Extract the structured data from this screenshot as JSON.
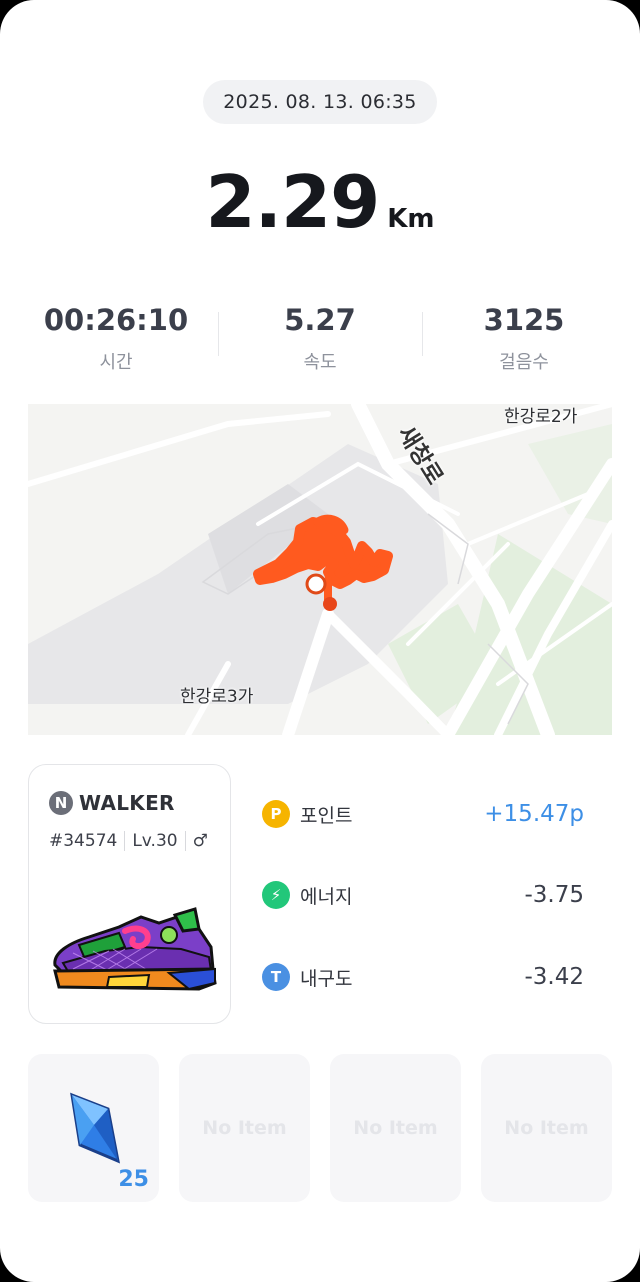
{
  "session": {
    "datetime": "2025. 08. 13. 06:35",
    "distance": "2.29",
    "distance_unit": "Km"
  },
  "stats": [
    {
      "value": "00:26:10",
      "label": "시간"
    },
    {
      "value": "5.27",
      "label": "속도"
    },
    {
      "value": "3125",
      "label": "걸음수"
    }
  ],
  "map": {
    "labels": {
      "area_top": "한강로2가",
      "road": "새창로",
      "area_bottom": "한강로3가"
    },
    "route_color": "#ff5a1f"
  },
  "walker": {
    "badge": "N",
    "name": "WALKER",
    "id": "#34574",
    "level": "Lv.30",
    "gender_symbol": "♂"
  },
  "rewards": [
    {
      "icon": "point-icon",
      "icon_text": "P",
      "color": "#f6b400",
      "label": "포인트",
      "value": "+15.47p",
      "positive": true
    },
    {
      "icon": "energy-icon",
      "icon_text": "⚡",
      "color": "#22c77a",
      "label": "에너지",
      "value": "-3.75",
      "positive": false
    },
    {
      "icon": "durability-icon",
      "icon_text": "T",
      "color": "#4a90e2",
      "label": "내구도",
      "value": "-3.42",
      "positive": false
    }
  ],
  "items": [
    {
      "type": "gem",
      "count": "25"
    },
    {
      "type": "empty",
      "text": "No Item"
    },
    {
      "type": "empty",
      "text": "No Item"
    },
    {
      "type": "empty",
      "text": "No Item"
    }
  ],
  "colors": {
    "accent_blue": "#3d8fe6",
    "route_orange": "#ff5a1f"
  }
}
